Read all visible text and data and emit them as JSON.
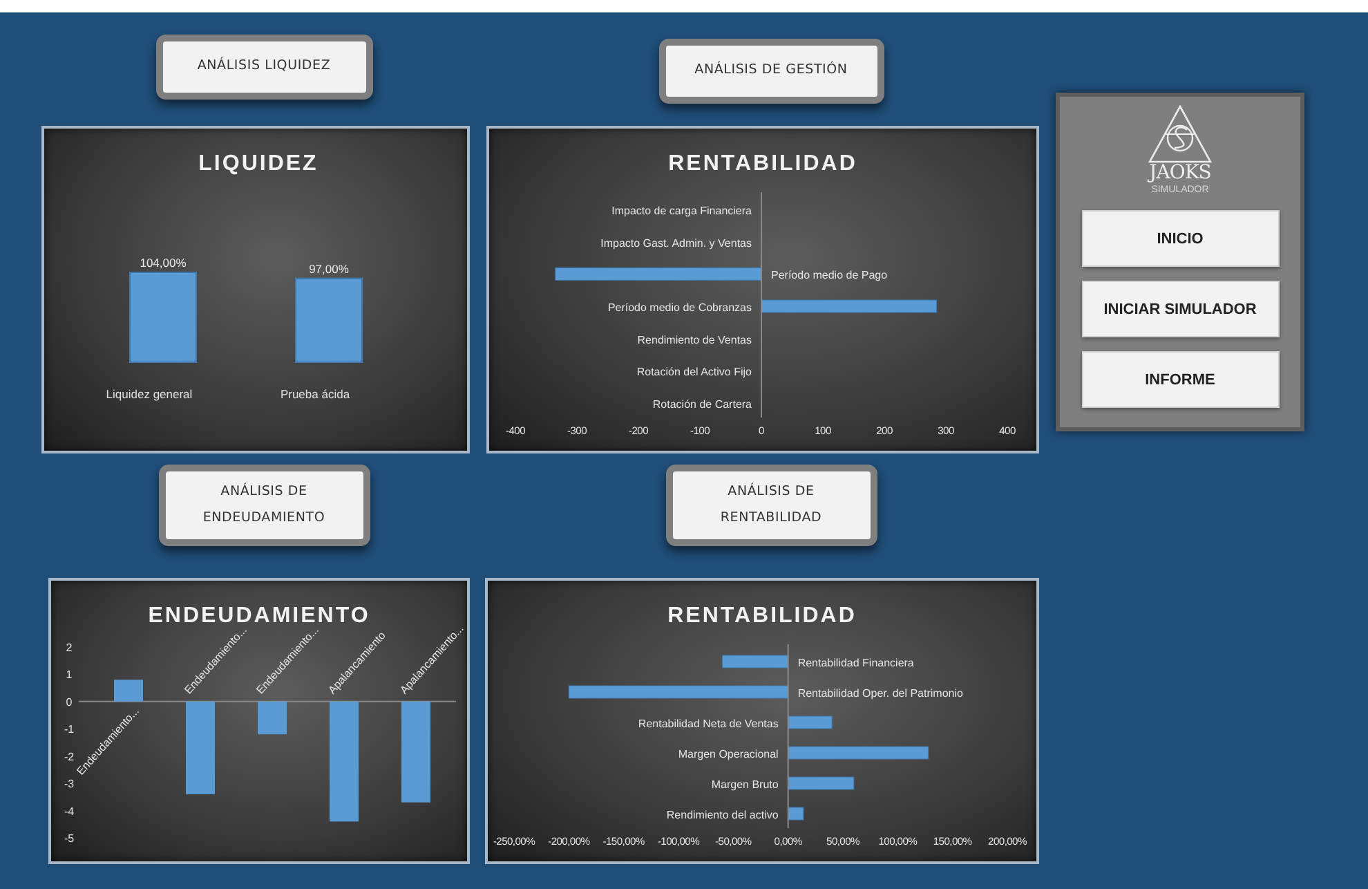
{
  "sections": [
    {
      "button": "ANÁLISIS LIQUIDEZ",
      "kind": "column3d",
      "chart_data": {
        "type": "bar",
        "title": "LIQUIDEZ",
        "orientation": "vertical",
        "categories": [
          "Liquidez general",
          "Prueba ácida"
        ],
        "values": [
          104,
          97
        ],
        "value_labels": [
          "104,00%",
          "97,00%"
        ]
      }
    },
    {
      "button": "ANÁLISIS DE GESTIÓN",
      "kind": "hbar",
      "chart_data": {
        "type": "bar",
        "title": "RENTABILIDAD",
        "orientation": "horizontal",
        "categories": [
          "Impacto de carga Financiera",
          "Impacto Gast. Admin. y Ventas",
          "Período medio de Pago",
          "Período medio de Cobranzas",
          "Rendimiento de Ventas",
          "Rotación del Activo Fijo",
          "Rotación de Cartera"
        ],
        "values": [
          0,
          0,
          -335,
          285,
          0,
          0,
          0
        ],
        "xlim": [
          -400,
          400
        ],
        "xticks": [
          -400,
          -300,
          -200,
          -100,
          0,
          100,
          200,
          300,
          400
        ]
      }
    },
    {
      "button": "ANÁLISIS DE ENDEUDAMIENTO",
      "kind": "column",
      "chart_data": {
        "type": "bar",
        "title": "ENDEUDAMIENTO",
        "orientation": "vertical",
        "categories": [
          "Endeudamiento...",
          "Endeudamiento...",
          "Endeudamiento...",
          "Apalancamiento",
          "Apalancamiento..."
        ],
        "values": [
          0.8,
          -3.4,
          -1.2,
          -4.4,
          -3.7
        ],
        "ylim": [
          -5,
          2
        ],
        "yticks": [
          2,
          1,
          0,
          -1,
          -2,
          -3,
          -4,
          -5
        ]
      }
    },
    {
      "button": "ANÁLISIS DE RENTABILIDAD",
      "kind": "hbar",
      "chart_data": {
        "type": "bar",
        "title": "RENTABILIDAD",
        "orientation": "horizontal",
        "categories": [
          "Rentabilidad Financiera",
          "Rentabilidad Oper. del Patrimonio",
          "Rentabilidad Neta de Ventas",
          "Margen Operacional",
          "Margen Bruto",
          "Rendimiento del activo"
        ],
        "values": [
          -60,
          -200,
          40,
          128,
          60,
          14
        ],
        "xlim": [
          -250,
          200
        ],
        "xticks": [
          {
            "value": -250,
            "label": "-250,00%"
          },
          {
            "value": -200,
            "label": "-200,00%"
          },
          {
            "value": -150,
            "label": "-150,00%"
          },
          {
            "value": -100,
            "label": "-100,00%"
          },
          {
            "value": -50,
            "label": "-50,00%"
          },
          {
            "value": 0,
            "label": "0,00%"
          },
          {
            "value": 50,
            "label": "50,00%"
          },
          {
            "value": 100,
            "label": "100,00%"
          },
          {
            "value": 150,
            "label": "150,00%"
          },
          {
            "value": 200,
            "label": "200,00%"
          }
        ]
      }
    }
  ],
  "menu": {
    "logo_name": "JAOKS",
    "logo_subtitle": "SIMULADOR",
    "buttons": [
      "INICIO",
      "INICIAR SIMULADOR",
      "INFORME"
    ]
  }
}
